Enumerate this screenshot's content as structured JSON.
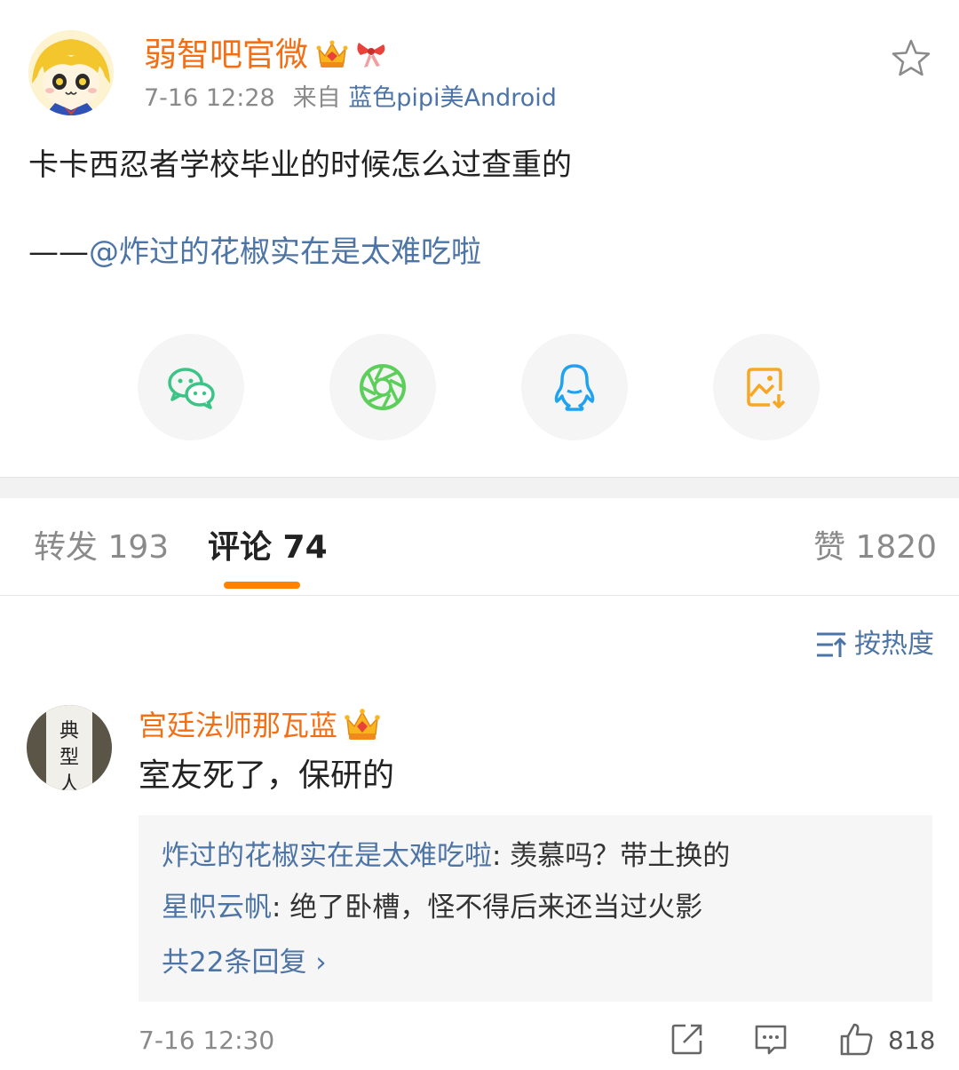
{
  "post": {
    "author": "弱智吧官微",
    "time": "7-16 12:28",
    "source_prefix": "来自",
    "source": "蓝色pipi美Android",
    "text": "卡卡西忍者学校毕业的时候怎么过查重的",
    "attribution_dash": "——",
    "attribution_mention": "@炸过的花椒实在是太难吃啦"
  },
  "share": [
    {
      "icon": "wechat-icon",
      "color": "#3cc486"
    },
    {
      "icon": "moments-icon",
      "color": "#5ccf5a"
    },
    {
      "icon": "qq-icon",
      "color": "#1fa3f1"
    },
    {
      "icon": "save-image-icon",
      "color": "#f7a722"
    }
  ],
  "tabs": {
    "repost": "转发 193",
    "comments": "评论 74",
    "likes": "赞 1820"
  },
  "sort_label": "按热度",
  "comment": {
    "author": "宫廷法师那瓦蓝",
    "text": "室友死了，保研的",
    "replies": [
      {
        "who": "炸过的花椒实在是太难吃啦",
        "text": ": 羡慕吗？带土换的"
      },
      {
        "who": "星帜云帆",
        "text": ": 绝了卧槽，怪不得后来还当过火影"
      }
    ],
    "more_replies": "共22条回复 ›",
    "time": "7-16 12:30",
    "likes": "818"
  },
  "colors": {
    "brand_orange": "#f36f16",
    "link_blue": "#4d74a6",
    "tab_indicator": "#ff8200"
  }
}
